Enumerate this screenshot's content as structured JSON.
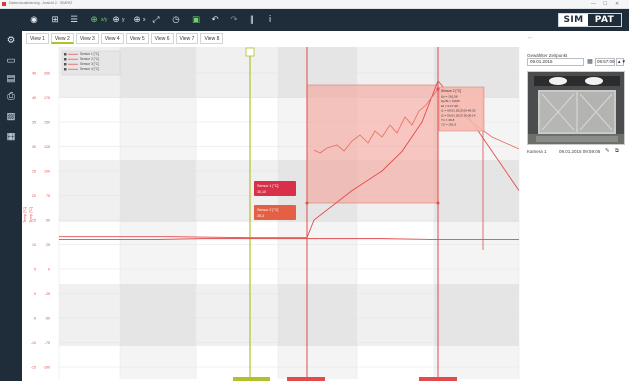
{
  "window": {
    "title": "Datenvisualisierung - Ansicht 2 - SIMPAT",
    "controls": [
      "—",
      "☐",
      "✕"
    ]
  },
  "toolbar": {
    "icons": [
      {
        "name": "eye-icon",
        "glyph": "◉",
        "style": ""
      },
      {
        "name": "grid-icon",
        "glyph": "⊞",
        "style": ""
      },
      {
        "name": "list-icon",
        "glyph": "☰",
        "style": ""
      },
      {
        "name": "zoom-xy-icon",
        "glyph": "⊕",
        "style": "green"
      },
      {
        "name": "zoom-y-icon",
        "glyph": "⊕",
        "style": ""
      },
      {
        "name": "zoom-x-icon",
        "glyph": "⊕",
        "style": ""
      },
      {
        "name": "fit-icon",
        "glyph": "⤢",
        "style": ""
      },
      {
        "name": "clock-icon",
        "glyph": "◷",
        "style": ""
      },
      {
        "name": "camera-icon",
        "glyph": "▣",
        "style": "green"
      },
      {
        "name": "undo-icon",
        "glyph": "↶",
        "style": ""
      },
      {
        "name": "redo-icon",
        "glyph": "↷",
        "style": "dim"
      },
      {
        "name": "pause-icon",
        "glyph": "∥",
        "style": ""
      },
      {
        "name": "info-icon",
        "glyph": "i",
        "style": ""
      }
    ],
    "icon_labels": [
      "x/y",
      "y",
      "x"
    ],
    "brand_left": "SIM",
    "brand_right": "PAT"
  },
  "sidebar": {
    "icons": [
      {
        "name": "settings-icon",
        "glyph": "⚙"
      },
      {
        "name": "folder-icon",
        "glyph": "▭"
      },
      {
        "name": "save-icon",
        "glyph": "▤"
      },
      {
        "name": "print-icon",
        "glyph": "⎙"
      },
      {
        "name": "image-icon",
        "glyph": "▨"
      },
      {
        "name": "document-icon",
        "glyph": "▦"
      }
    ]
  },
  "tabs": [
    {
      "label": "View 1",
      "active": false
    },
    {
      "label": "View 2",
      "active": true
    },
    {
      "label": "View 3",
      "active": false
    },
    {
      "label": "View 4",
      "active": false
    },
    {
      "label": "View 5",
      "active": false
    },
    {
      "label": "View 6",
      "active": false
    },
    {
      "label": "View 7",
      "active": false
    },
    {
      "label": "View 8",
      "active": false
    }
  ],
  "colors": {
    "accent_green": "#b4c02a",
    "sensor_red": "#e14b4b",
    "highlight_fill": "#f5a79e",
    "toolbar_bg": "#1f2c3a"
  },
  "chart_data": {
    "type": "line",
    "legend": [
      "Sensor 1 [°C]",
      "Sensor 2 [°C]",
      "Sensor 3 [°C]",
      "Sensor 4 [°C]"
    ],
    "y_axis_label": "Temp [°C]",
    "y_ticks": [
      "200",
      "175",
      "150",
      "125",
      "100",
      "75",
      "50",
      "25",
      "0",
      "-25",
      "-50",
      "-75",
      "-100"
    ],
    "y_ticks_secondary": [
      "45",
      "40",
      "35",
      "30",
      "25",
      "20",
      "15",
      "10",
      "5",
      "0",
      "-5",
      "-10",
      "-15"
    ],
    "series": [
      {
        "name": "Sensor 1 [°C]",
        "values": [
          30,
          30,
          30,
          31,
          31,
          31,
          31,
          31,
          31,
          30,
          30,
          30
        ]
      },
      {
        "name": "Sensor 2 [°C]",
        "values": [
          33,
          33,
          32,
          32,
          50,
          80,
          100,
          120,
          150,
          192,
          150,
          80
        ]
      }
    ],
    "callout_sensor1": {
      "title": "Sensor 1 [°C]",
      "value": "30,10"
    },
    "callout_sensor2": {
      "title": "Sensor 2 [°C]",
      "value": "28,3"
    },
    "measure_box": {
      "title": "Sensor 2 [°C]",
      "lines": [
        "Δy = 161,08",
        "Δy/Δt = 0,096",
        "Δt = 0:17:49",
        "t1 = 09.01.2015 09:48:25",
        "t2 = 09.01.2015 10:06:14",
        "Y1 = 30,8",
        "Y2 = 191,9"
      ]
    },
    "grid": true
  },
  "right_panel": {
    "back": "←",
    "label": "Gewählter Zeitpunkt",
    "date": "09.01.2015",
    "time": "09:57:09",
    "spin": "▲▼",
    "camera_name": "Kamera 1",
    "camera_time": "09.01.2015 09:59:06"
  }
}
